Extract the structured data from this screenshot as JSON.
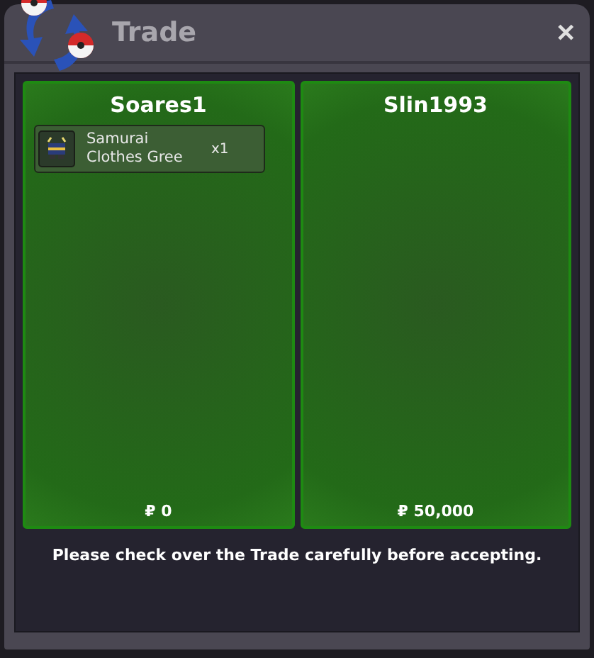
{
  "window": {
    "title": "Trade",
    "close": "✕"
  },
  "offers": [
    {
      "player": "Soares1",
      "items": [
        {
          "name": "Samurai Clothes Gree",
          "quantity": "x1"
        }
      ],
      "money": "₽ 0"
    },
    {
      "player": "Slin1993",
      "money": "₽ 50,000"
    }
  ],
  "message": "Please check over the Trade carefully before accepting."
}
